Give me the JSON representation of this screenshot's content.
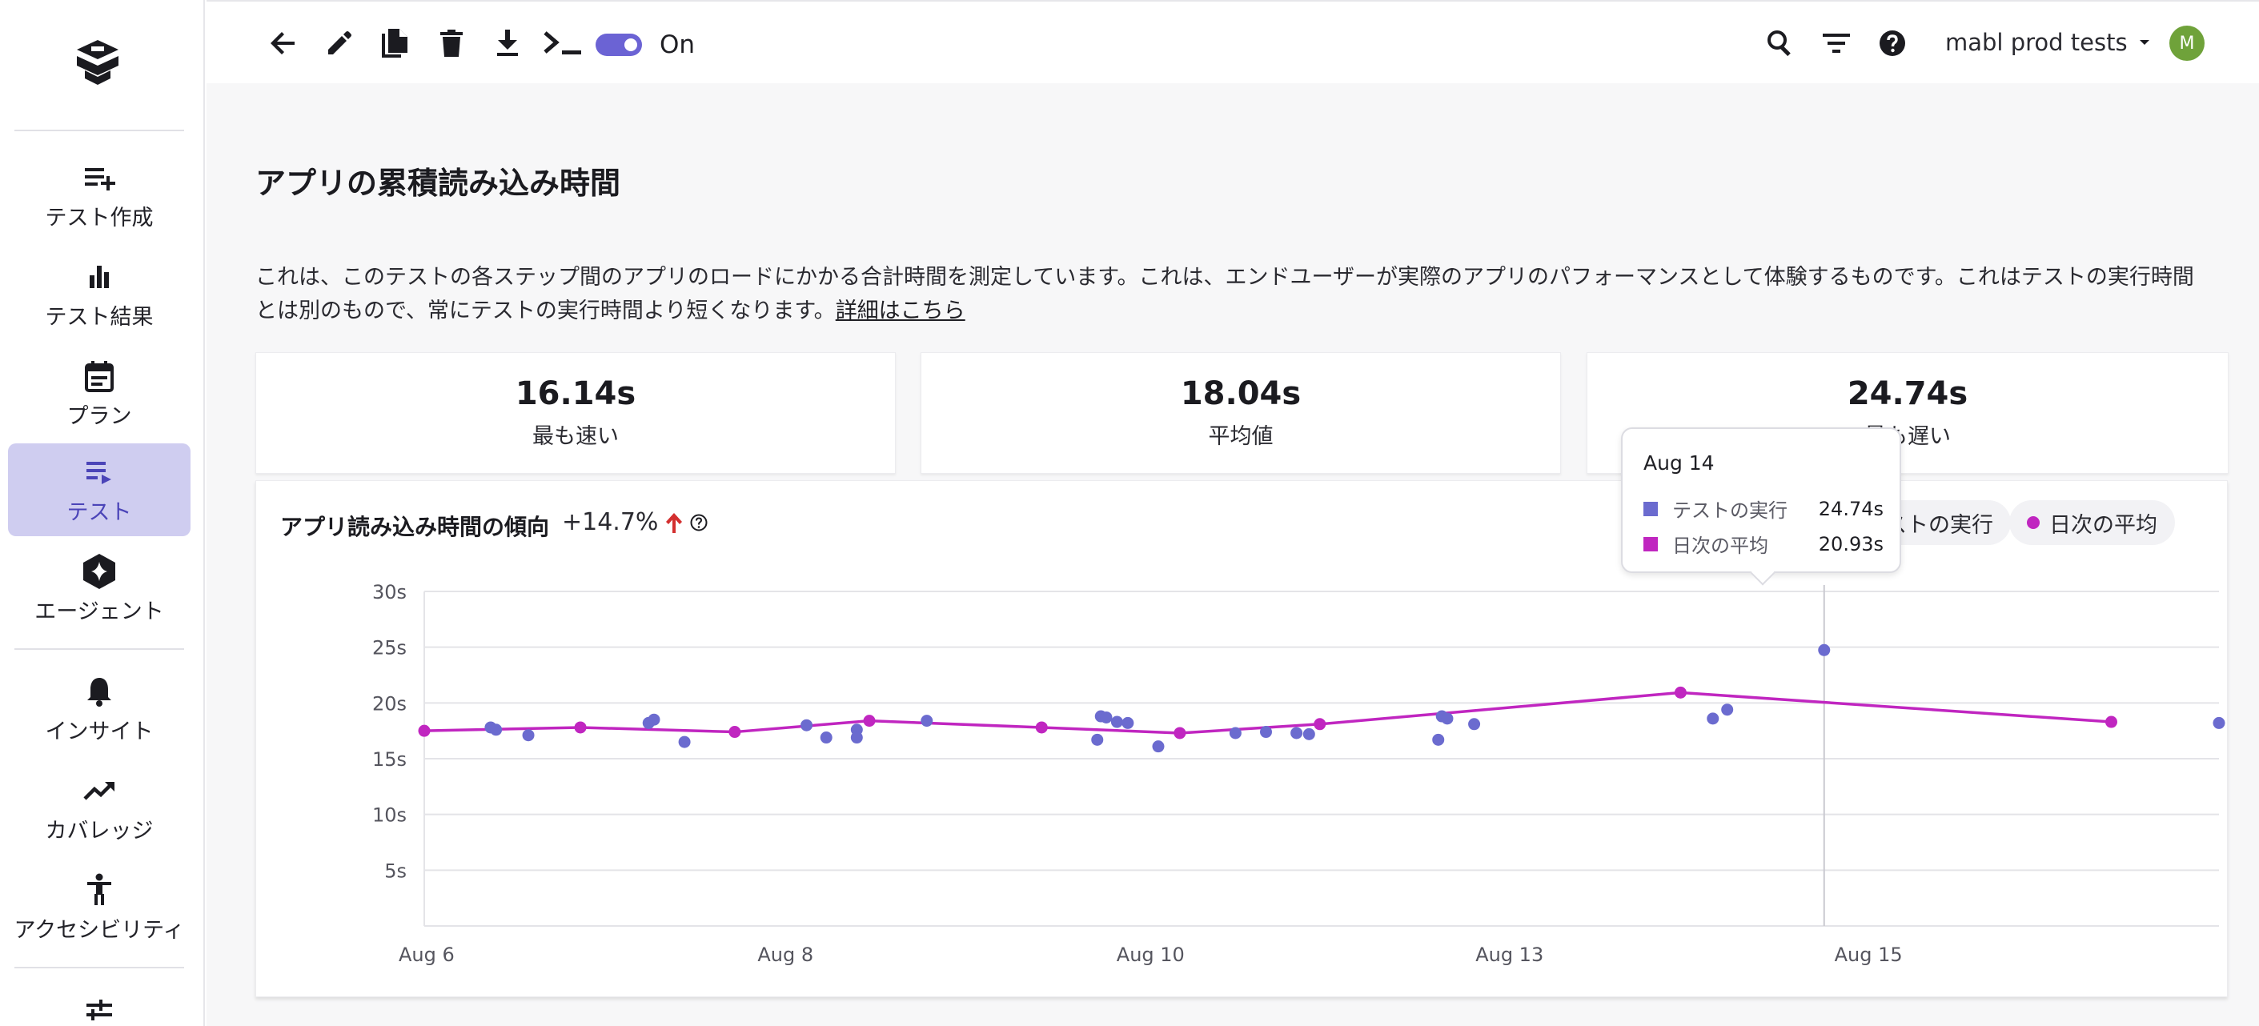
{
  "sidebar": {
    "items": [
      {
        "label": "テスト作成",
        "icon": "playlist-add-icon"
      },
      {
        "label": "テスト結果",
        "icon": "bar-chart-icon"
      },
      {
        "label": "プラン",
        "icon": "calendar-icon"
      },
      {
        "label": "テスト",
        "icon": "playlist-play-icon",
        "active": true
      },
      {
        "label": "エージェント",
        "icon": "sparkle-hexagon-icon"
      },
      {
        "label": "インサイト",
        "icon": "bell-icon"
      },
      {
        "label": "カバレッジ",
        "icon": "trending-up-icon"
      },
      {
        "label": "アクセシビリティ",
        "icon": "accessibility-icon"
      }
    ]
  },
  "topbar": {
    "toggle_label": "On",
    "toggle_on": true,
    "workspace": "mabl prod tests",
    "avatar_initial": "M"
  },
  "page": {
    "title": "アプリの累積読み込み時間",
    "description": "これは、このテストの各ステップ間のアプリのロードにかかる合計時間を測定しています。これは、エンドユーザーが実際のアプリのパフォーマンスとして体験するものです。これはテストの実行時間とは別のもので、常にテストの実行時間より短くなります。",
    "details_link": "詳細はこちら"
  },
  "stats": [
    {
      "value": "16.14s",
      "label": "最も速い"
    },
    {
      "value": "18.04s",
      "label": "平均値"
    },
    {
      "value": "24.74s",
      "label": "最も遅い"
    }
  ],
  "chart_header": {
    "title": "アプリ読み込み時間の傾向",
    "trend": "+14.7%",
    "legend": [
      {
        "label": "テストの実行",
        "color": "#6b6bcf"
      },
      {
        "label": "日次の平均",
        "color": "#c026c0"
      }
    ]
  },
  "tooltip": {
    "date": "Aug 14",
    "rows": [
      {
        "name": "テストの実行",
        "value": "24.74s",
        "color": "#6b6bcf"
      },
      {
        "name": "日次の平均",
        "value": "20.93s",
        "color": "#c026c0"
      }
    ]
  },
  "colors": {
    "accent": "#6b63d4",
    "runs": "#6b6bcf",
    "average": "#c026c0",
    "trend_up": "#d32f2f"
  },
  "chart_data": {
    "type": "scatter",
    "ylim": [
      0,
      30
    ],
    "y_ticks": [
      "5s",
      "10s",
      "15s",
      "20s",
      "25s",
      "30s"
    ],
    "x_ticks": [
      "Aug 6",
      "Aug 8",
      "Aug 10",
      "Aug 13",
      "Aug 15"
    ],
    "x_tick_day": [
      6,
      8,
      10,
      12,
      14
    ],
    "xlim_day": [
      6,
      16
    ],
    "series": [
      {
        "name": "テストの実行",
        "mode": "markers",
        "points": [
          [
            6.37,
            17.8
          ],
          [
            6.4,
            17.6
          ],
          [
            6.58,
            17.1
          ],
          [
            7.25,
            18.2
          ],
          [
            7.28,
            18.5
          ],
          [
            7.45,
            16.5
          ],
          [
            8.13,
            18.0
          ],
          [
            8.24,
            16.9
          ],
          [
            8.41,
            17.6
          ],
          [
            8.41,
            16.9
          ],
          [
            8.8,
            18.4
          ],
          [
            9.77,
            18.8
          ],
          [
            9.8,
            18.7
          ],
          [
            9.75,
            16.7
          ],
          [
            9.86,
            18.3
          ],
          [
            9.92,
            18.2
          ],
          [
            10.09,
            16.1
          ],
          [
            10.52,
            17.3
          ],
          [
            10.69,
            17.4
          ],
          [
            10.86,
            17.3
          ],
          [
            10.93,
            17.2
          ],
          [
            11.67,
            18.8
          ],
          [
            11.65,
            16.7
          ],
          [
            11.7,
            18.6
          ],
          [
            11.85,
            18.1
          ],
          [
            13.18,
            18.6
          ],
          [
            13.26,
            19.4
          ],
          [
            13.8,
            24.74
          ],
          [
            16.0,
            18.2
          ]
        ]
      },
      {
        "name": "日次の平均",
        "mode": "lines+markers",
        "points": [
          [
            6.0,
            17.5
          ],
          [
            6.87,
            17.8
          ],
          [
            7.73,
            17.4
          ],
          [
            8.48,
            18.4
          ],
          [
            9.44,
            17.8
          ],
          [
            10.21,
            17.3
          ],
          [
            10.99,
            18.1
          ],
          [
            13.0,
            20.93
          ],
          [
            15.4,
            18.3
          ]
        ]
      }
    ],
    "hover_day": 13.8
  }
}
